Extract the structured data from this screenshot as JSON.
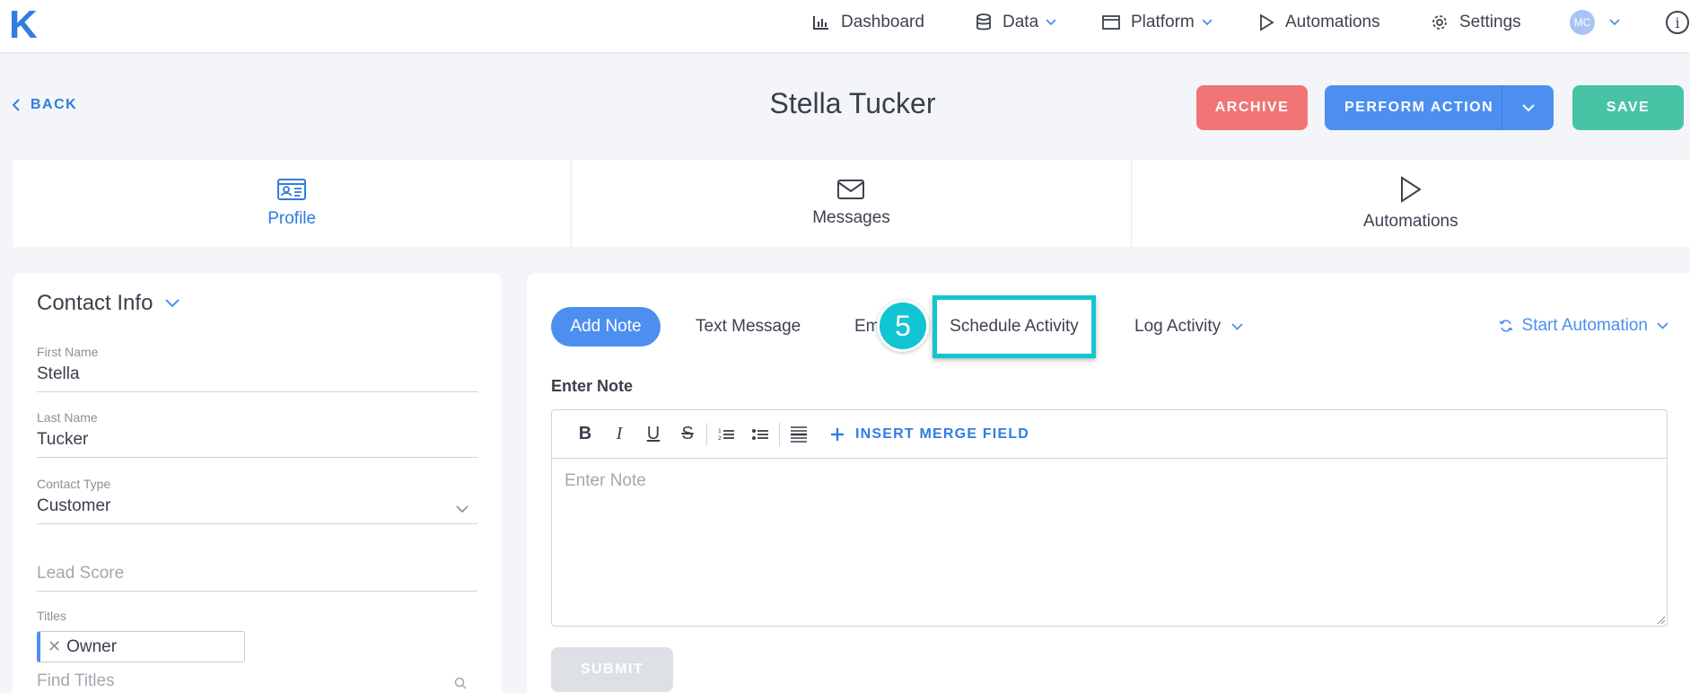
{
  "nav": {
    "logo": "K",
    "items": [
      {
        "label": "Dashboard",
        "icon": "bar-chart-icon"
      },
      {
        "label": "Data",
        "icon": "database-icon"
      },
      {
        "label": "Platform",
        "icon": "window-icon"
      },
      {
        "label": "Automations",
        "icon": "play-icon"
      },
      {
        "label": "Settings",
        "icon": "gear-icon"
      }
    ],
    "avatar_initials": "MC",
    "info_glyph": "i"
  },
  "header": {
    "back_label": "BACK",
    "title": "Stella Tucker",
    "archive_label": "ARCHIVE",
    "perform_label": "PERFORM ACTION",
    "save_label": "SAVE"
  },
  "tabs": [
    {
      "label": "Profile",
      "icon": "id-card-icon",
      "active": true
    },
    {
      "label": "Messages",
      "icon": "envelope-icon",
      "active": false
    },
    {
      "label": "Automations",
      "icon": "play-icon",
      "active": false
    }
  ],
  "contact": {
    "heading": "Contact Info",
    "first_name_label": "First Name",
    "first_name": "Stella",
    "last_name_label": "Last Name",
    "last_name": "Tucker",
    "type_label": "Contact Type",
    "type_value": "Customer",
    "lead_score_placeholder": "Lead Score",
    "titles_label": "Titles",
    "title_tag": "Owner",
    "find_titles_placeholder": "Find Titles"
  },
  "activity": {
    "tabs": [
      "Add Note",
      "Text Message",
      "Em",
      "Schedule Activity",
      "Log Activity"
    ],
    "step_number": "5",
    "start_automation": "Start Automation",
    "note_label": "Enter Note",
    "merge_label": "INSERT MERGE FIELD",
    "note_placeholder": "Enter Note",
    "submit_label": "SUBMIT",
    "toolbar": {
      "bold": "B",
      "italic": "I",
      "underline": "U",
      "strike": "S"
    }
  },
  "colors": {
    "accent": "#2f7de1",
    "archive": "#f07574",
    "perform": "#4d8ff0",
    "save": "#48c3a6",
    "highlight": "#12c5d2"
  }
}
